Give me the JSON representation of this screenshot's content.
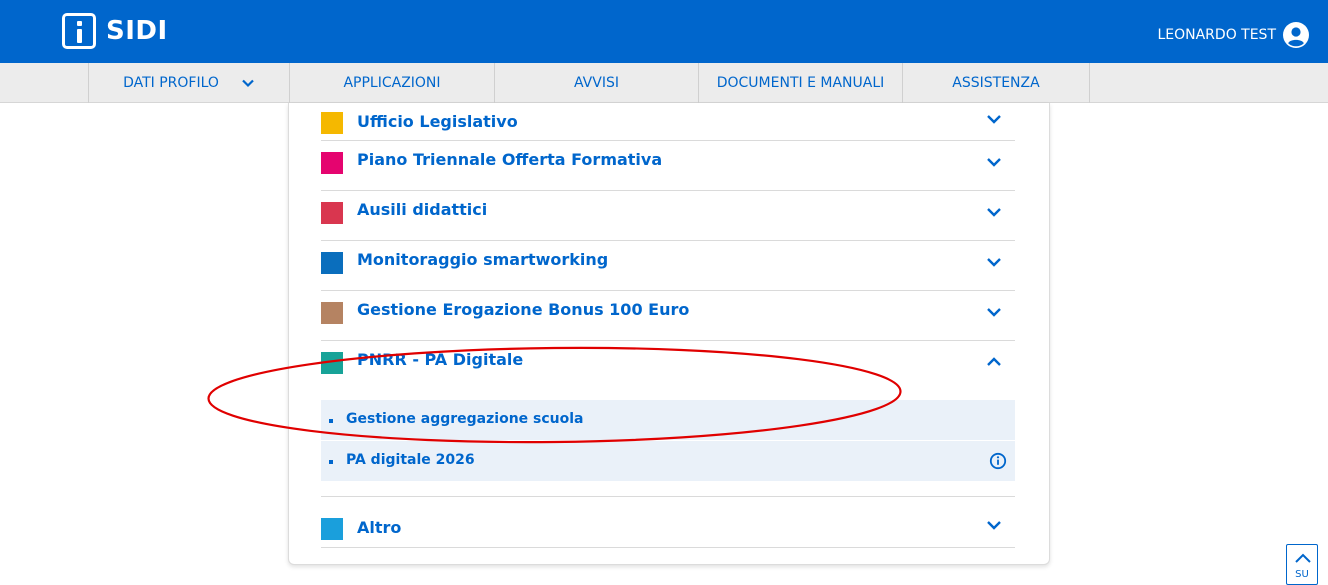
{
  "header": {
    "logo_text": "SIDI",
    "user_name": "LEONARDO TEST"
  },
  "nav": {
    "items": [
      {
        "label": "DATI PROFILO",
        "has_dropdown": true
      },
      {
        "label": "APPLICAZIONI"
      },
      {
        "label": "AVVISI"
      },
      {
        "label": "DOCUMENTI E MANUALI"
      },
      {
        "label": "ASSISTENZA"
      }
    ]
  },
  "sections": [
    {
      "label": "Ufficio Legislativo",
      "color": "#f5b800",
      "expanded": false
    },
    {
      "label": "Piano Triennale Offerta Formativa",
      "color": "#e5046f",
      "expanded": false
    },
    {
      "label": "Ausili didattici",
      "color": "#d9364f",
      "expanded": false
    },
    {
      "label": "Monitoraggio smartworking",
      "color": "#0a6ebd",
      "expanded": false
    },
    {
      "label": "Gestione Erogazione Bonus 100 Euro",
      "color": "#b58362",
      "expanded": false
    },
    {
      "label": "PNRR - PA Digitale",
      "color": "#17a398",
      "expanded": true,
      "items": [
        {
          "label": "Gestione aggregazione scuola",
          "has_info": false
        },
        {
          "label": "PA digitale 2026",
          "has_info": true
        }
      ]
    },
    {
      "label": "Altro",
      "color": "#1a9fdc",
      "expanded": false
    }
  ],
  "back_to_top": {
    "label": "SU"
  },
  "colors": {
    "brand": "#0066cc",
    "annotation": "#e00000"
  }
}
